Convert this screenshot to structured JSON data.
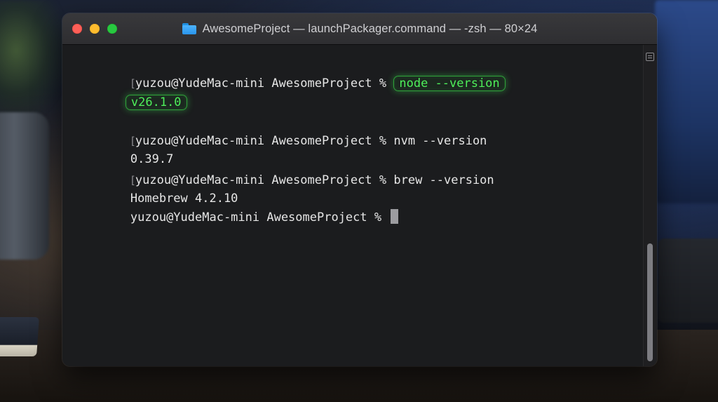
{
  "window": {
    "title": "AwesomeProject — launchPackager.command — -zsh — 80×24"
  },
  "terminal": {
    "lines": [
      {
        "prompt": "yuzou@YudeMac-mini AwesomeProject % ",
        "command": "node --version"
      },
      {
        "output": "v26.1.0"
      },
      {
        "prompt": "yuzou@YudeMac-mini AwesomeProject % ",
        "command": "nvm --version"
      },
      {
        "output": "0.39.7"
      },
      {
        "prompt": "yuzou@YudeMac-mini AwesomeProject % ",
        "command": "brew --version"
      },
      {
        "output": "Homebrew 4.2.10"
      },
      {
        "prompt": "yuzou@YudeMac-mini AwesomeProject % "
      }
    ],
    "highlight_color": "#4ef05a"
  },
  "icons": {
    "folder": "folder-icon",
    "scroll_marker": "scroll-marker-icon"
  },
  "colors": {
    "close": "#fe5f57",
    "minimize": "#febc2e",
    "zoom": "#28c840"
  }
}
